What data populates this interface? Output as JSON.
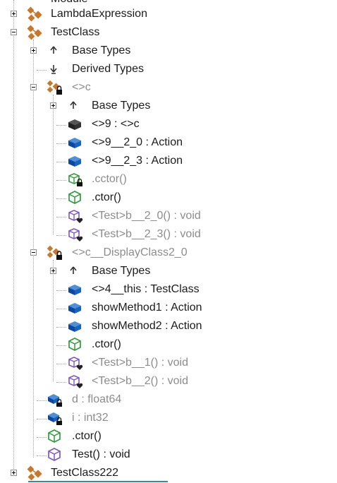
{
  "tree": {
    "top_partial_label": "Module",
    "items": [
      {
        "label": "LambdaExpression",
        "gray": false
      },
      {
        "label": "TestClass",
        "gray": false
      },
      {
        "label": "Base Types",
        "gray": false
      },
      {
        "label": "Derived Types",
        "gray": false
      },
      {
        "label": "<>c",
        "gray": true
      },
      {
        "label": "Base Types",
        "gray": false
      },
      {
        "label": "<>9 : <>c",
        "gray": false
      },
      {
        "label": "<>9__2_0 : Action",
        "gray": false
      },
      {
        "label": "<>9__2_3 : Action",
        "gray": false
      },
      {
        "label": ".cctor()",
        "gray": true
      },
      {
        "label": ".ctor()",
        "gray": false
      },
      {
        "label": "<Test>b__2_0() : void",
        "gray": true
      },
      {
        "label": "<Test>b__2_3() : void",
        "gray": true
      },
      {
        "label": "<>c__DisplayClass2_0",
        "gray": true
      },
      {
        "label": "Base Types",
        "gray": false
      },
      {
        "label": "<>4__this : TestClass",
        "gray": false
      },
      {
        "label": "showMethod1 : Action",
        "gray": false
      },
      {
        "label": "showMethod2 : Action",
        "gray": false
      },
      {
        "label": ".ctor()",
        "gray": false
      },
      {
        "label": "<Test>b__1() : void",
        "gray": true
      },
      {
        "label": "<Test>b__2() : void",
        "gray": true
      },
      {
        "label": "d : float64",
        "gray": true
      },
      {
        "label": "i : int32",
        "gray": true
      },
      {
        "label": ".ctor()",
        "gray": false
      },
      {
        "label": "Test() : void",
        "gray": false
      },
      {
        "label": "TestClass222",
        "gray": false
      }
    ]
  },
  "colors": {
    "class_icon": "#c8782a",
    "field_icon": "#1565c0",
    "method_icon": "#7e57c2",
    "ctor_icon": "#2e9d3a",
    "gray_text": "#8c8c8c"
  }
}
